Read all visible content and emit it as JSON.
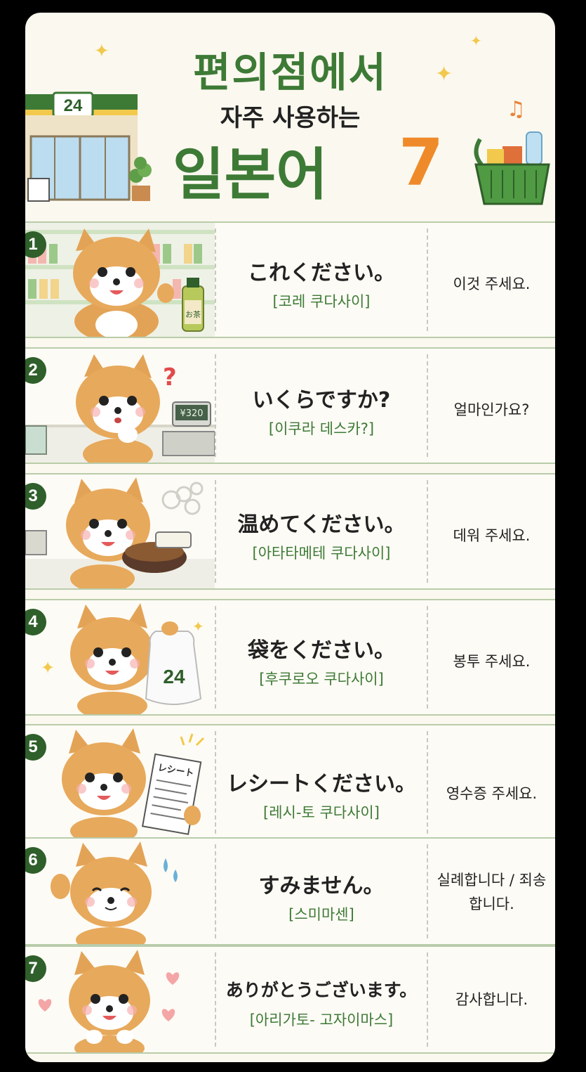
{
  "header": {
    "title_line1": "편의점에서",
    "title_line2": "자주 사용하는",
    "title_line3": "일본어",
    "title_number": "7",
    "store_sign": "24"
  },
  "rows": [
    {
      "num": "1",
      "jp": "これください。",
      "reading": "[코레 쿠다사이]",
      "ko": "이것 주세요.",
      "bottle_label": "お茶"
    },
    {
      "num": "2",
      "jp": "いくらですか?",
      "reading": "[이쿠라 데스카?]",
      "ko": "얼마인가요?",
      "price": "¥320"
    },
    {
      "num": "3",
      "jp": "温めてください。",
      "reading": "[아타타메테 쿠다사이]",
      "ko": "데워 주세요."
    },
    {
      "num": "4",
      "jp": "袋をください。",
      "reading": "[후쿠로오 쿠다사이]",
      "ko": "봉투 주세요.",
      "bag_label": "24"
    },
    {
      "num": "5",
      "jp": "レシートください。",
      "reading": "[레시-토 쿠다사이]",
      "ko": "영수증 주세요.",
      "receipt_label": "レシート"
    },
    {
      "num": "6",
      "jp": "すみません。",
      "reading": "[스미마센]",
      "ko": "실례합니다 / 죄송합니다."
    },
    {
      "num": "7",
      "jp": "ありがとうございます。",
      "reading": "[아리가토- 고자이마스]",
      "ko": "감사합니다."
    }
  ],
  "colors": {
    "green": "#3d7a36",
    "orange": "#ef8a2a",
    "badge": "#2f5f2a"
  }
}
